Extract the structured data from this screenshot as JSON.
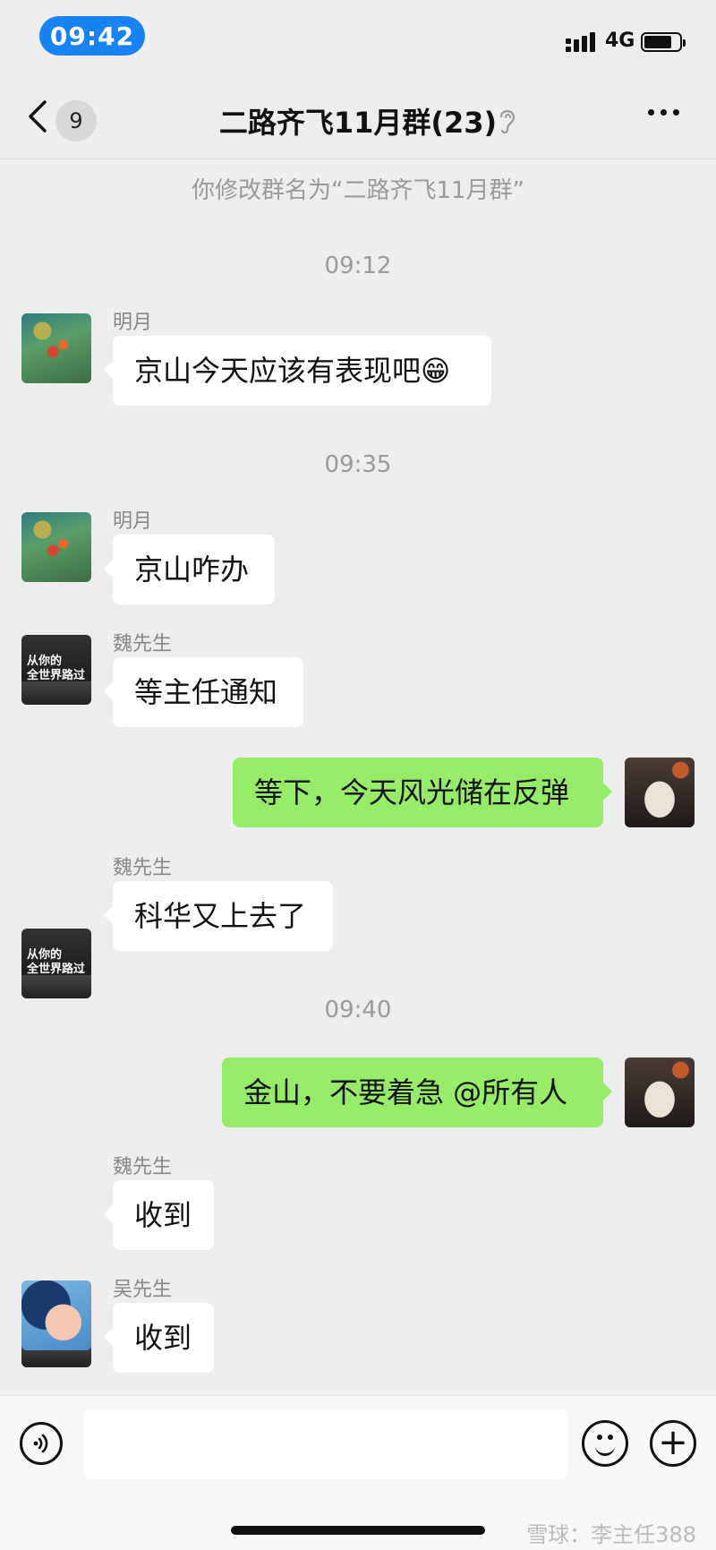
{
  "status_bar": {
    "time": "09:42",
    "network": "4G"
  },
  "header": {
    "unread_count": "9",
    "title": "二路齐飞11月群(23)"
  },
  "system_notice": "你修改群名为“二路齐飞11月群”",
  "timestamps": [
    "09:12",
    "09:35",
    "09:40"
  ],
  "messages": [
    {
      "sender": "明月",
      "text": "京山今天应该有表现吧",
      "emoji": "😁"
    },
    {
      "sender": "明月",
      "text": "京山咋办"
    },
    {
      "sender": "魏先生",
      "text": "等主任通知"
    },
    {
      "sender": "",
      "text": "等下，今天风光储在反弹"
    },
    {
      "sender": "魏先生",
      "text": "科华又上去了"
    },
    {
      "sender": "",
      "text": "金山，不要着急 @所有人"
    },
    {
      "sender": "魏先生",
      "text": "收到"
    },
    {
      "sender": "吴先生",
      "text": "收到"
    }
  ],
  "poster_avatar_text": [
    "从你的",
    "全世界路过"
  ],
  "watermark": "雪球：李主任388",
  "colors": {
    "outgoing_bubble": "#95ec69",
    "incoming_bubble": "#ffffff",
    "time_pill": "#1a82f7",
    "background": "#ededed"
  }
}
